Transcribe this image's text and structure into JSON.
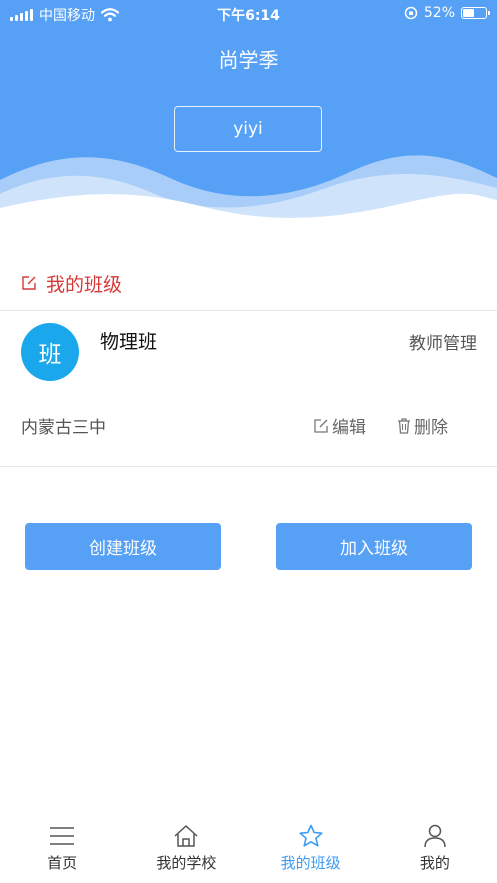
{
  "status_bar": {
    "carrier": "中国移动",
    "time": "下午6:14",
    "battery_text": "52%",
    "battery_level": 0.52
  },
  "header": {
    "title": "尚学季",
    "username": "yiyi"
  },
  "section": {
    "title": "我的班级"
  },
  "class_card": {
    "avatar_text": "班",
    "name": "物理班",
    "role": "教师管理",
    "school": "内蒙古三中",
    "edit_label": "编辑",
    "delete_label": "删除"
  },
  "actions": {
    "create_label": "创建班级",
    "join_label": "加入班级"
  },
  "tabs": [
    {
      "label": "首页",
      "icon": "menu-icon",
      "active": false
    },
    {
      "label": "我的学校",
      "icon": "home-icon",
      "active": false
    },
    {
      "label": "我的班级",
      "icon": "star-icon",
      "active": true
    },
    {
      "label": "我的",
      "icon": "user-icon",
      "active": false
    }
  ],
  "colors": {
    "primary": "#56a0f5",
    "avatar": "#1aa7ec",
    "section_title": "#d83a3a",
    "active_tab": "#3d9bf2"
  }
}
